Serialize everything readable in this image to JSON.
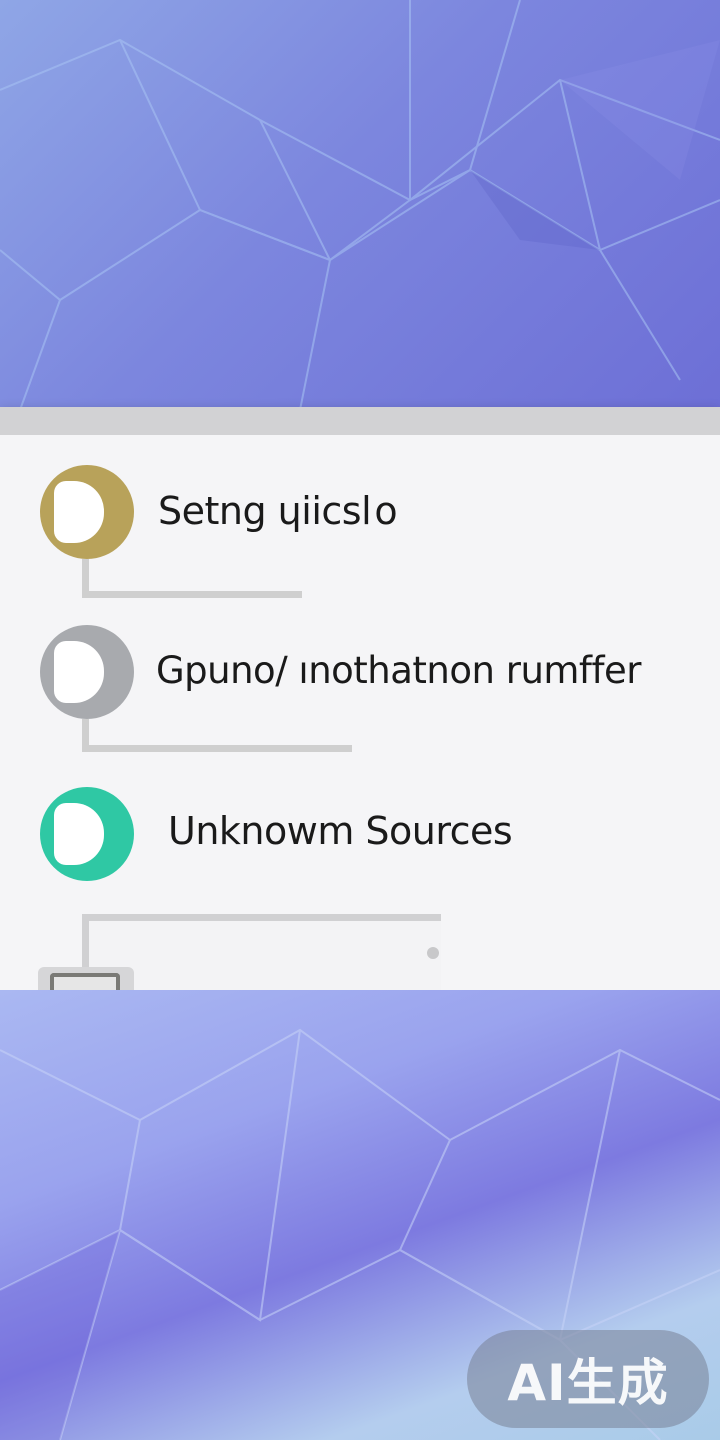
{
  "settings_list": {
    "items": [
      {
        "label": "Setng ɥiicsl o",
        "icon": "circle-icon",
        "accent": "#b8a25a"
      },
      {
        "label": "Gpuno/ ınothatnon rumffer",
        "icon": "circle-icon",
        "accent": "#a8aaae"
      },
      {
        "label": "Unknowm Sources",
        "icon": "circle-icon",
        "accent": "#2fc8a4"
      }
    ]
  },
  "watermark": {
    "text": "AI生成"
  },
  "colors": {
    "panel_bg": "#f5f5f7",
    "gold": "#b8a25a",
    "gray": "#a8aaae",
    "teal": "#2fc8a4"
  }
}
